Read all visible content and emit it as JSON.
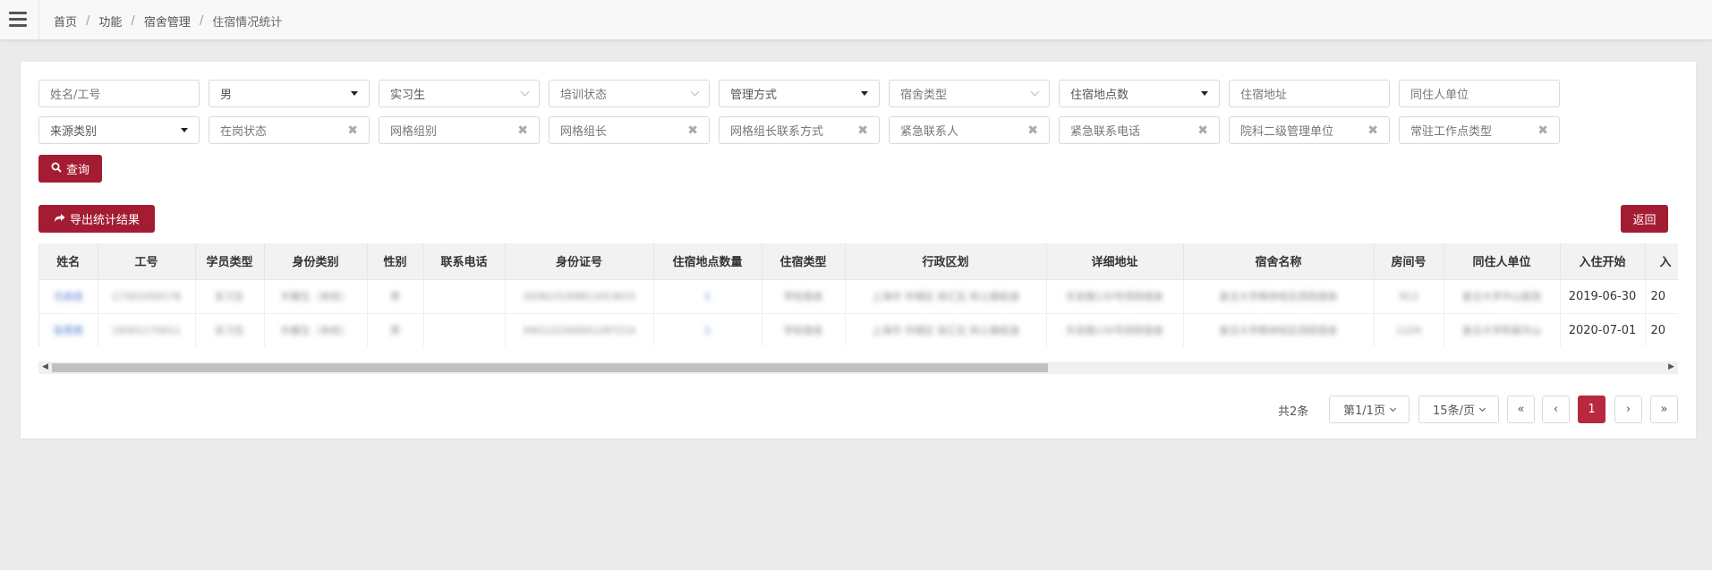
{
  "breadcrumb": [
    "首页",
    "功能",
    "宿舍管理",
    "住宿情况统计"
  ],
  "filters": {
    "name": "姓名/工号",
    "gender": "男",
    "student_type": "实习生",
    "training_status": "培训状态",
    "manage_mode": "管理方式",
    "dorm_type": "宿舍类型",
    "dorm_count": "住宿地点数",
    "dorm_address": "住宿地址",
    "roommate_unit": "同住人单位",
    "source_type": "来源类别",
    "onpost_status": "在岗状态",
    "grid_group": "网格组别",
    "grid_leader": "网格组长",
    "grid_leader_phone": "网格组长联系方式",
    "emergency_contact": "紧急联系人",
    "emergency_phone": "紧急联系电话",
    "secondary_unit": "院科二级管理单位",
    "work_point_type": "常驻工作点类型"
  },
  "buttons": {
    "query": "查询",
    "export": "导出统计结果",
    "back": "返回"
  },
  "table": {
    "headers": [
      "姓名",
      "工号",
      "学员类型",
      "身份类别",
      "性别",
      "联系电话",
      "身份证号",
      "住宿地点数量",
      "住宿类型",
      "行政区划",
      "详细地址",
      "宿舍名称",
      "房间号",
      "同住人单位",
      "入住开始",
      "入"
    ],
    "rows": [
      [
        "方启佳",
        "17301050178",
        "实习生",
        "外籍生（本校）",
        "男",
        "",
        "320623199811053615",
        "1",
        "学校宿舍",
        "上海市 市辖区 徐汇区 斜土路街道",
        "东安路130号西院宿舍",
        "复旦大学枫林校区西院宿舍",
        "913",
        "复旦大学中山医院",
        "2019-06-30",
        "20"
      ],
      [
        "张思雨",
        "19301170011",
        "实习生",
        "外籍生（本校）",
        "男",
        "",
        "34012220000128721X",
        "1",
        "学校宿舍",
        "上海市 市辖区 徐汇区 斜土路街道",
        "东安路130号西院宿舍",
        "复旦大学枫林校区西院宿舍",
        "1224",
        "复旦大学附属华山",
        "2020-07-01",
        "20"
      ]
    ]
  },
  "pagination": {
    "total": "共2条",
    "page_select": "第1/1页",
    "size_select": "15条/页",
    "first": "«",
    "prev": "‹",
    "current": "1",
    "next": "›",
    "last": "»"
  },
  "colors": {
    "accent": "#a41c32",
    "page_active": "#b8283f",
    "link": "#4a73c9"
  }
}
